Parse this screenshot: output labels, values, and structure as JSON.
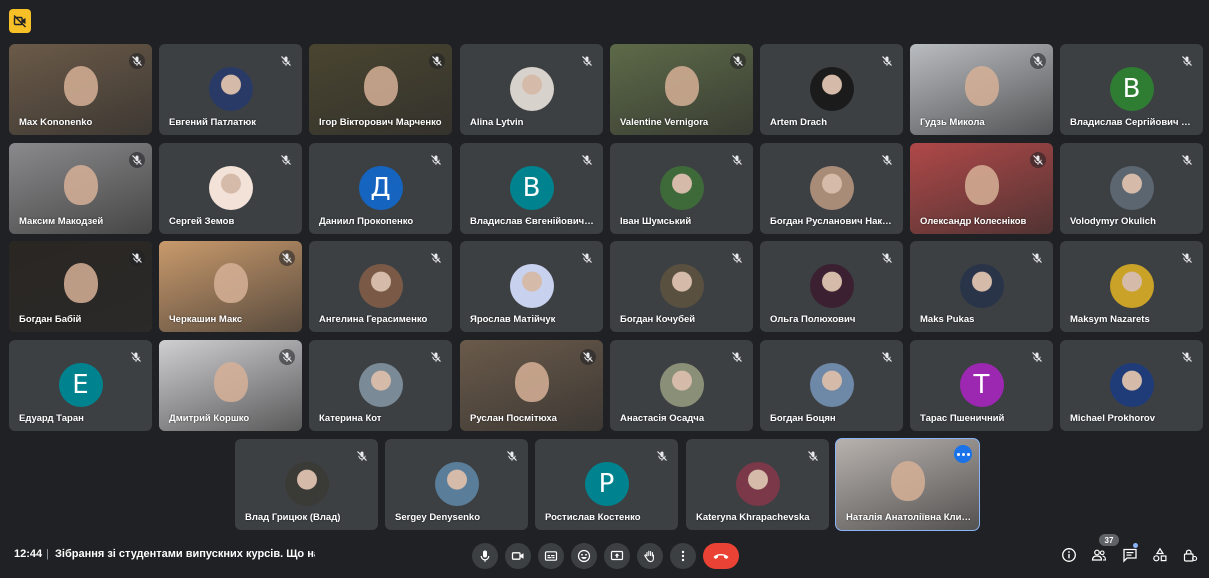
{
  "meeting": {
    "time": "12:44",
    "separator": "|",
    "title": "Зібрання зі студентами випускних курсів. Що нас ...",
    "participant_count": "37"
  },
  "colors": {
    "background": "#202124",
    "tile": "#3c4043",
    "hangup": "#ea4335",
    "active_outline": "#8ab4f8",
    "camera_off_badge": "#f6c026"
  },
  "toolbar": {
    "mic": "mic-icon",
    "camera": "camera-icon",
    "captions": "captions-icon",
    "emoji": "emoji-icon",
    "present": "present-icon",
    "hand": "raise-hand-icon",
    "more": "more-options-icon",
    "leave": "hangup-icon"
  },
  "side_controls": [
    "info-icon",
    "people-icon",
    "chat-icon",
    "activities-icon",
    "host-controls-icon"
  ],
  "rows": [
    [
      {
        "name": "Max Kononenko",
        "kind": "video",
        "bg": "#6b5a48"
      },
      {
        "name": "Евгений Патлатюк",
        "kind": "avatar",
        "bg": "#2a3a66"
      },
      {
        "name": "Ігор Вікторович Марченко",
        "kind": "video",
        "bg": "#4a4530"
      },
      {
        "name": "Alina Lytvin",
        "kind": "avatar",
        "bg": "#d8d2cc"
      },
      {
        "name": "Valentine Vernigora",
        "kind": "video",
        "bg": "#5d6a48"
      },
      {
        "name": "Artem Drach",
        "kind": "avatar",
        "bg": "#1b1b1b"
      },
      {
        "name": "Гудзь Микола",
        "kind": "video",
        "bg": "#b9bcc0"
      },
      {
        "name": "Владислав Сергійович Тар...",
        "kind": "letter",
        "letter": "В",
        "bg": "#2f7d32"
      }
    ],
    [
      {
        "name": "Максим Макодзей",
        "kind": "video",
        "bg": "#8a8a8c"
      },
      {
        "name": "Сергей Земов",
        "kind": "avatar",
        "bg": "#f2e2d8"
      },
      {
        "name": "Даниил Прокопенко",
        "kind": "letter",
        "letter": "Д",
        "bg": "#1565c0"
      },
      {
        "name": "Владислав Євгенійович В...",
        "kind": "letter",
        "letter": "В",
        "bg": "#00838f"
      },
      {
        "name": "Іван Шумський",
        "kind": "avatar",
        "bg": "#3e6a3a"
      },
      {
        "name": "Богдан Русланович Након...",
        "kind": "avatar",
        "bg": "#a98c78"
      },
      {
        "name": "Олександр Колесніков",
        "kind": "video",
        "bg": "#b04848"
      },
      {
        "name": "Volodymyr Okulich",
        "kind": "avatar",
        "bg": "#5c6670"
      }
    ],
    [
      {
        "name": "Богдан Бабій",
        "kind": "video",
        "bg": "#2a2622"
      },
      {
        "name": "Черкашин Макс",
        "kind": "video",
        "bg": "#c99a6c"
      },
      {
        "name": "Ангелина Герасименко",
        "kind": "avatar",
        "bg": "#7a5a46"
      },
      {
        "name": "Ярослав Матійчук",
        "kind": "avatar",
        "bg": "#c8d2ee"
      },
      {
        "name": "Богдан Кочубей",
        "kind": "avatar",
        "bg": "#5a5040"
      },
      {
        "name": "Ольга Полюхович",
        "kind": "avatar",
        "bg": "#3a2030"
      },
      {
        "name": "Maks Pukas",
        "kind": "avatar",
        "bg": "#2a3448"
      },
      {
        "name": "Maksym Nazarets",
        "kind": "avatar",
        "bg": "#c9a227"
      }
    ],
    [
      {
        "name": "Едуард Таран",
        "kind": "letter",
        "letter": "Е",
        "bg": "#00838f"
      },
      {
        "name": "Дмитрий Коршко",
        "kind": "video",
        "bg": "#cfcfd2"
      },
      {
        "name": "Катерина Кот",
        "kind": "avatar",
        "bg": "#7a8a96"
      },
      {
        "name": "Руслан Посмітюха",
        "kind": "video",
        "bg": "#6a5a4a"
      },
      {
        "name": "Анастасія Осадча",
        "kind": "avatar",
        "bg": "#8a9078"
      },
      {
        "name": "Богдан Боцян",
        "kind": "avatar",
        "bg": "#6e88a8"
      },
      {
        "name": "Тарас Пшеничний",
        "kind": "letter",
        "letter": "Т",
        "bg": "#9c27b0"
      },
      {
        "name": "Michael Prokhorov",
        "kind": "avatar",
        "bg": "#1f3c78"
      }
    ],
    [
      {
        "name": "Влад Грицюк (Влад)",
        "kind": "avatar",
        "bg": "#3a3a36"
      },
      {
        "name": "Sergey Denysenko",
        "kind": "avatar",
        "bg": "#5a7e9a"
      },
      {
        "name": "Ростислав Костенко",
        "kind": "letter",
        "letter": "Р",
        "bg": "#00838f"
      },
      {
        "name": "Kateryna Khrapachevska",
        "kind": "avatar",
        "bg": "#7a3848"
      },
      {
        "name": "Наталія Анатоліївна Клим...",
        "kind": "video",
        "bg": "#b8b2ae",
        "active": true
      }
    ]
  ]
}
